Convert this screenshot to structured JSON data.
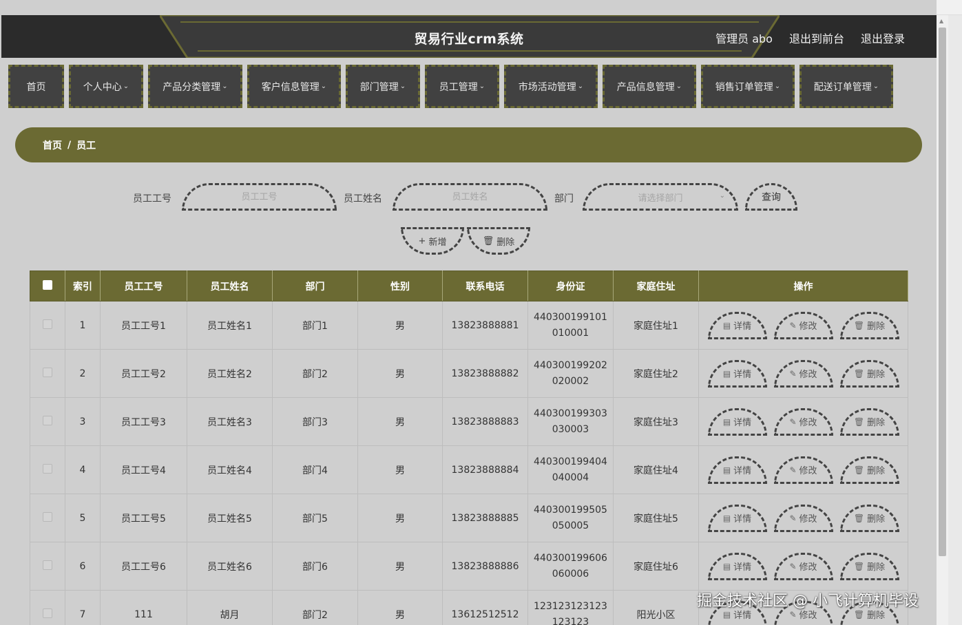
{
  "header": {
    "title": "贸易行业crm系统",
    "admin_label": "管理员 abo",
    "back_link": "退出到前台",
    "logout_link": "退出登录"
  },
  "nav": [
    {
      "label": "首页",
      "dropdown": false
    },
    {
      "label": "个人中心",
      "dropdown": true
    },
    {
      "label": "产品分类管理",
      "dropdown": true
    },
    {
      "label": "客户信息管理",
      "dropdown": true
    },
    {
      "label": "部门管理",
      "dropdown": true
    },
    {
      "label": "员工管理",
      "dropdown": true
    },
    {
      "label": "市场活动管理",
      "dropdown": true
    },
    {
      "label": "产品信息管理",
      "dropdown": true
    },
    {
      "label": "销售订单管理",
      "dropdown": true
    },
    {
      "label": "配送订单管理",
      "dropdown": true
    }
  ],
  "breadcrumb": {
    "home": "首页",
    "separator": "/",
    "current": "员工"
  },
  "search": {
    "emp_no_label": "员工工号",
    "emp_no_placeholder": "员工工号",
    "emp_name_label": "员工姓名",
    "emp_name_placeholder": "员工姓名",
    "dept_label": "部门",
    "dept_placeholder": "请选择部门",
    "query_button": "查询"
  },
  "actions": {
    "add": "新增",
    "delete": "删除"
  },
  "table": {
    "columns": [
      "索引",
      "员工工号",
      "员工姓名",
      "部门",
      "性别",
      "联系电话",
      "身份证",
      "家庭住址",
      "操作"
    ],
    "op_labels": {
      "detail": "详情",
      "edit": "修改",
      "delete": "删除"
    },
    "rows": [
      {
        "index": "1",
        "no": "员工工号1",
        "name": "员工姓名1",
        "dept": "部门1",
        "gender": "男",
        "phone": "13823888881",
        "id_line1": "440300199101",
        "id_line2": "010001",
        "address": "家庭住址1"
      },
      {
        "index": "2",
        "no": "员工工号2",
        "name": "员工姓名2",
        "dept": "部门2",
        "gender": "男",
        "phone": "13823888882",
        "id_line1": "440300199202",
        "id_line2": "020002",
        "address": "家庭住址2"
      },
      {
        "index": "3",
        "no": "员工工号3",
        "name": "员工姓名3",
        "dept": "部门3",
        "gender": "男",
        "phone": "13823888883",
        "id_line1": "440300199303",
        "id_line2": "030003",
        "address": "家庭住址3"
      },
      {
        "index": "4",
        "no": "员工工号4",
        "name": "员工姓名4",
        "dept": "部门4",
        "gender": "男",
        "phone": "13823888884",
        "id_line1": "440300199404",
        "id_line2": "040004",
        "address": "家庭住址4"
      },
      {
        "index": "5",
        "no": "员工工号5",
        "name": "员工姓名5",
        "dept": "部门5",
        "gender": "男",
        "phone": "13823888885",
        "id_line1": "440300199505",
        "id_line2": "050005",
        "address": "家庭住址5"
      },
      {
        "index": "6",
        "no": "员工工号6",
        "name": "员工姓名6",
        "dept": "部门6",
        "gender": "男",
        "phone": "13823888886",
        "id_line1": "440300199606",
        "id_line2": "060006",
        "address": "家庭住址6"
      },
      {
        "index": "7",
        "no": "111",
        "name": "胡月",
        "dept": "部门2",
        "gender": "男",
        "phone": "13612512512",
        "id_line1": "123123123123",
        "id_line2": "123123",
        "address": "阳光小区"
      }
    ]
  },
  "watermark": "掘金技术社区 @ 小飞计算机毕设",
  "colors": {
    "accent": "#6b6a33",
    "header_bg": "#2b2b2b",
    "nav_bg": "#414141",
    "page_bg": "#cfcfcf"
  }
}
